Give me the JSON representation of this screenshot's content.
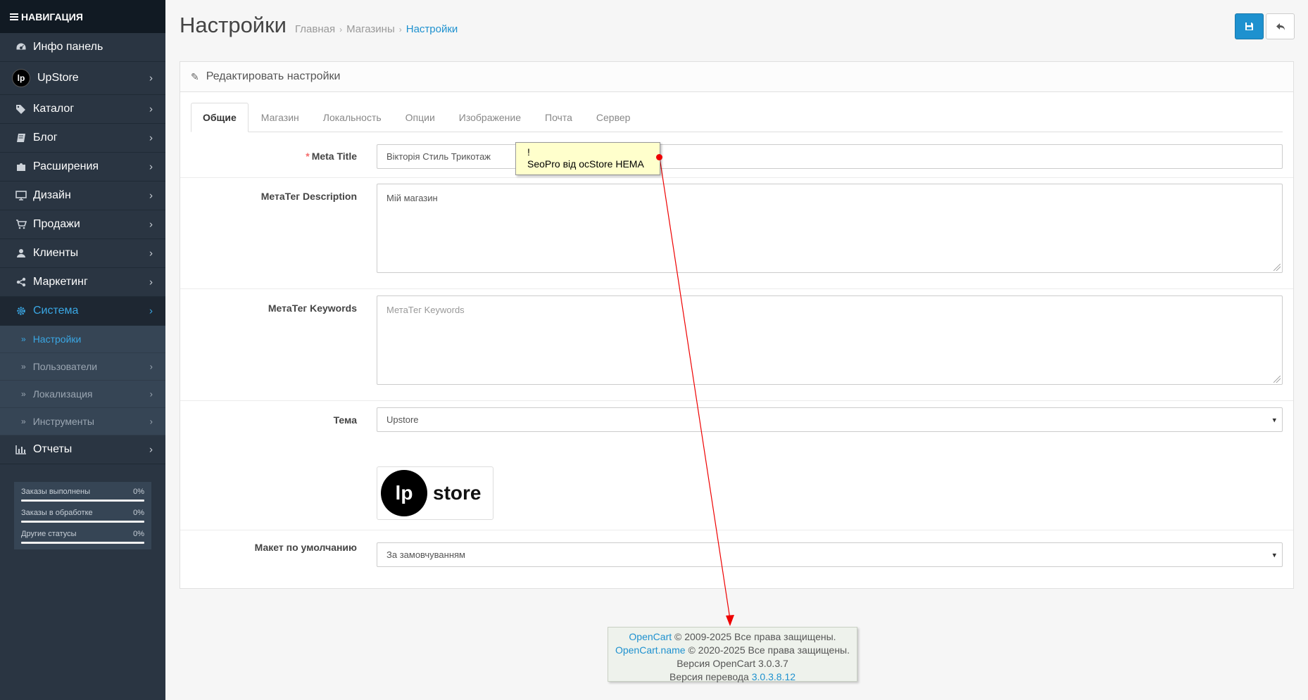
{
  "sidebar": {
    "header": "НАВИГАЦИЯ",
    "items": [
      {
        "label": "Инфо панель",
        "icon": "dashboard-icon"
      },
      {
        "label": "UpStore",
        "icon": "upstore-logo"
      },
      {
        "label": "Каталог",
        "icon": "tags-icon"
      },
      {
        "label": "Блог",
        "icon": "book-icon"
      },
      {
        "label": "Расширения",
        "icon": "puzzle-icon"
      },
      {
        "label": "Дизайн",
        "icon": "desktop-icon"
      },
      {
        "label": "Продажи",
        "icon": "cart-icon"
      },
      {
        "label": "Клиенты",
        "icon": "user-icon"
      },
      {
        "label": "Маркетинг",
        "icon": "share-icon"
      },
      {
        "label": "Система",
        "icon": "cog-icon"
      }
    ],
    "upstore_logo_text": "lp",
    "system_submenu": [
      "Настройки",
      "Пользователи",
      "Локализация",
      "Инструменты"
    ],
    "reports": {
      "label": "Отчеты",
      "icon": "bar-chart-icon"
    },
    "stats": [
      {
        "label": "Заказы выполнены",
        "value": "0%",
        "progress": 0
      },
      {
        "label": "Заказы в обработке",
        "value": "0%",
        "progress": 0
      },
      {
        "label": "Другие статусы",
        "value": "0%",
        "progress": 0
      }
    ]
  },
  "header": {
    "title": "Настройки",
    "breadcrumb": [
      "Главная",
      "Магазины",
      "Настройки"
    ],
    "save_icon": "save-icon",
    "back_icon": "reply-icon"
  },
  "panel": {
    "title": "Редактировать настройки",
    "tabs": [
      "Общие",
      "Магазин",
      "Локальность",
      "Опции",
      "Изображение",
      "Почта",
      "Сервер"
    ],
    "active_tab": "Общие"
  },
  "form": {
    "meta_title": {
      "label": "Meta Title",
      "required_mark": "*",
      "value": "Вікторія Стиль Трикотаж"
    },
    "meta_description": {
      "label": "МетаТег Description",
      "value": "Мій магазин"
    },
    "meta_keywords": {
      "label": "МетаТег Keywords",
      "placeholder": "МетаТег Keywords"
    },
    "theme": {
      "label": "Тема",
      "value": "Upstore",
      "thumb_circle": "lp",
      "thumb_text": "store"
    },
    "layout": {
      "label": "Макет по умолчанию",
      "value": "За замовчуванням"
    }
  },
  "note": {
    "line1": "!",
    "line2": "SeoPro від ocStore HEMA"
  },
  "footer": {
    "opencart_link": "OpenCart",
    "line1_rest": " © 2009-2025 Все права защищены.",
    "opencartname_link": "OpenCart.name",
    "line2_rest": " © 2020-2025 Все права защищены.",
    "version": "Версия OpenCart 3.0.3.7",
    "translation_prefix": "Версия перевода ",
    "translation_version": "3.0.3.8.12"
  },
  "colors": {
    "sidebar_bg": "#2a3542",
    "accent": "#1e91cf",
    "active_nav": "#3aa7e4",
    "required": "#f56b6b"
  }
}
